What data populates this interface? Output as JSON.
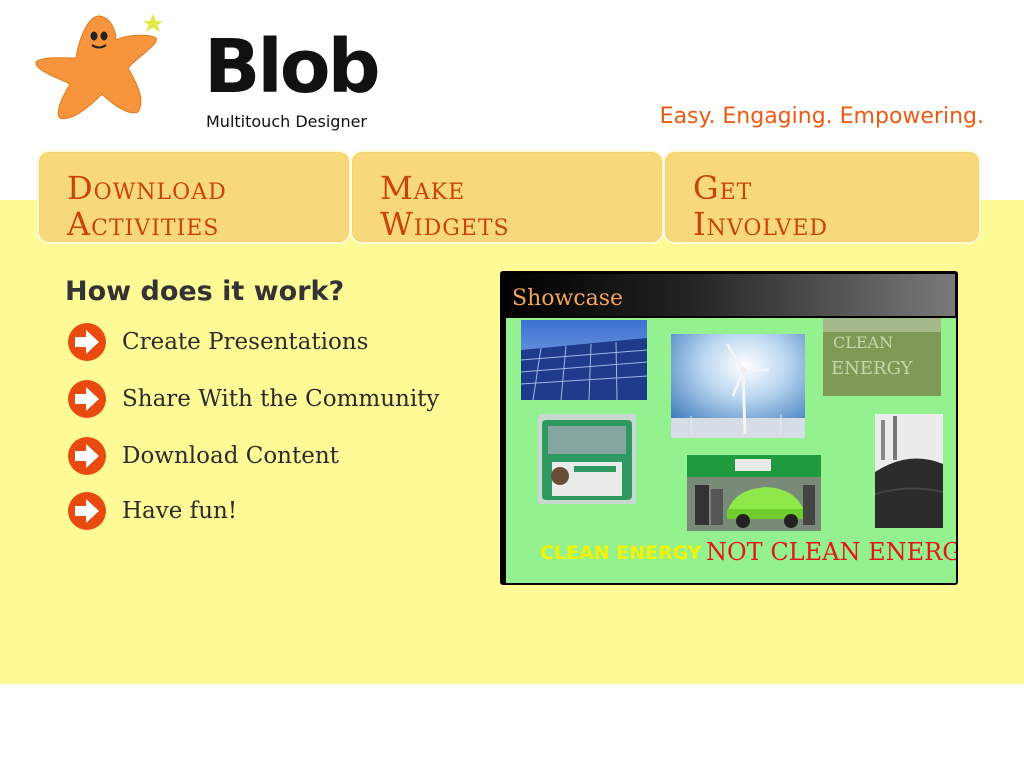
{
  "brand": {
    "name": "Blob",
    "subtitle": "Multitouch Designer",
    "tagline": "Easy. Engaging. Empowering."
  },
  "nav": {
    "tabs": [
      {
        "line1": "Download",
        "line2": "Activities"
      },
      {
        "line1": "Make",
        "line2": "Widgets"
      },
      {
        "line1": "Get",
        "line2": "Involved"
      }
    ]
  },
  "how": {
    "title": "How does it work?",
    "steps": [
      {
        "label": "Create Presentations",
        "icon": "arrow-right-icon"
      },
      {
        "label": "Share With the Community",
        "icon": "arrow-right-icon"
      },
      {
        "label": "Download Content",
        "icon": "arrow-right-icon"
      },
      {
        "label": "Have fun!",
        "icon": "arrow-right-icon"
      }
    ]
  },
  "showcase": {
    "title": "Showcase",
    "captions": {
      "clean": "CLEAN ENERGY",
      "not_clean": "NOT CLEAN ENERGY"
    },
    "images": [
      "solar-panels",
      "wind-turbine",
      "clean-energy-field",
      "bus-with-passenger",
      "electric-car-expo",
      "coal-pile"
    ]
  },
  "colors": {
    "accent": "#ea5a12",
    "tab_bg": "#f7d97b",
    "band": "#fefb97",
    "showcase_bg": "#93f28f"
  }
}
